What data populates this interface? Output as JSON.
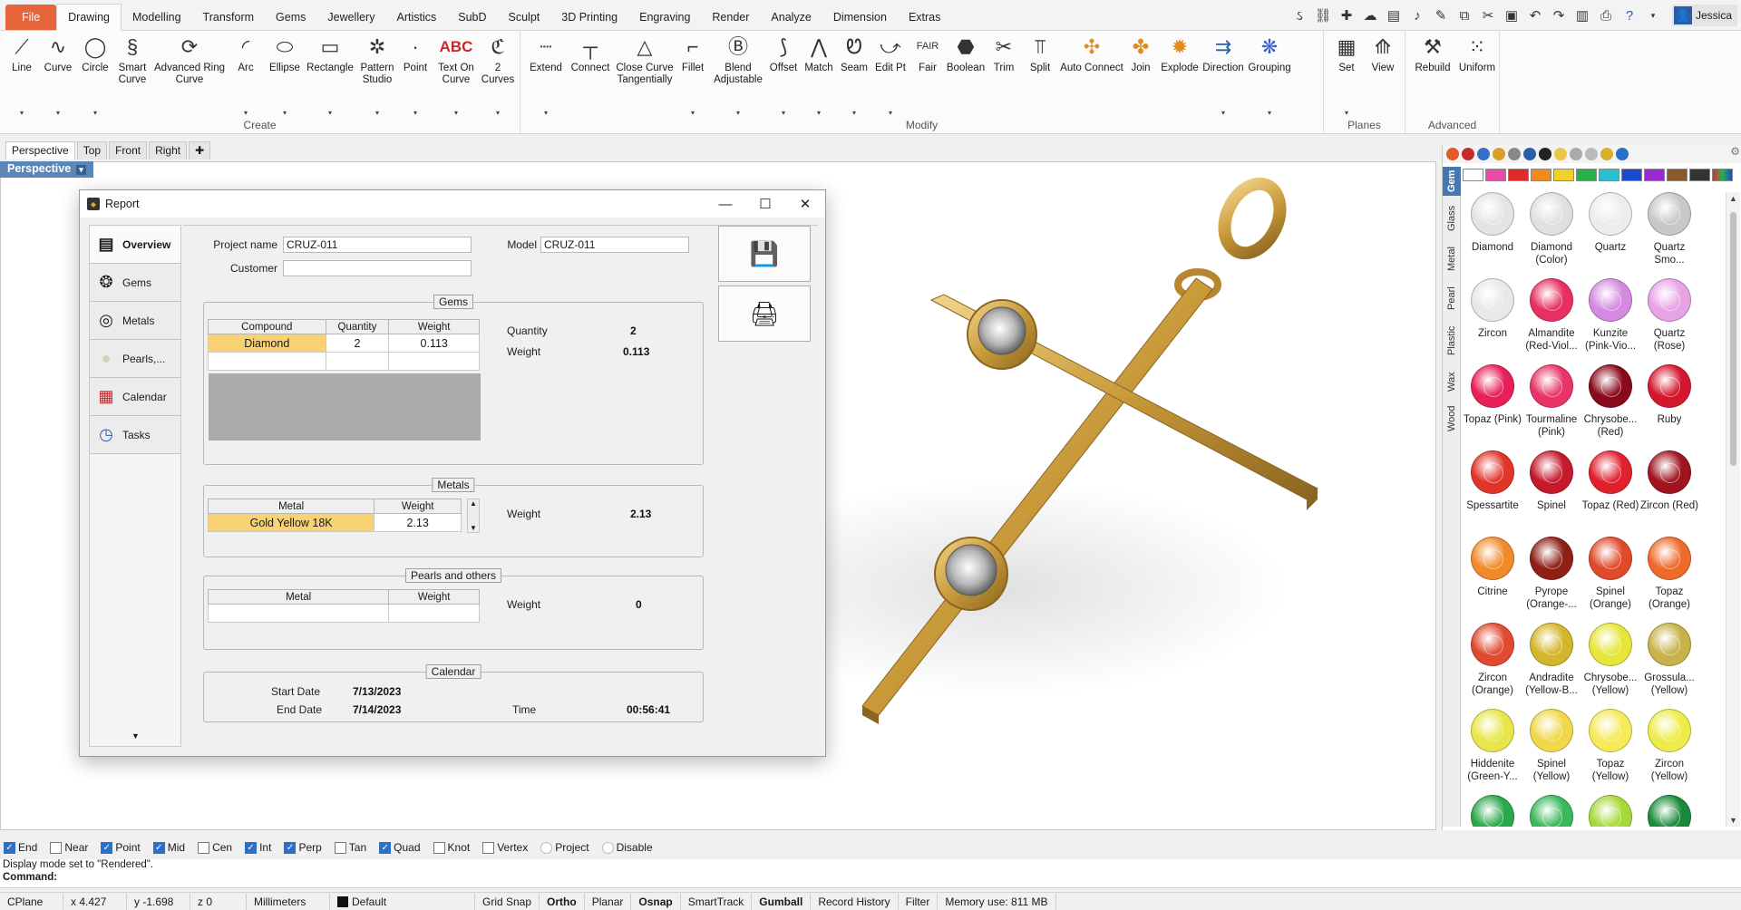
{
  "ribbon_tabs": [
    "File",
    "Drawing",
    "Modelling",
    "Transform",
    "Gems",
    "Jewellery",
    "Artistics",
    "SubD",
    "Sculpt",
    "3D Printing",
    "Engraving",
    "Render",
    "Analyze",
    "Dimension",
    "Extras"
  ],
  "active_tab": "Drawing",
  "user": "Jessica",
  "ribbon": {
    "create": {
      "label": "Create",
      "buttons": [
        "Line",
        "Curve",
        "Circle",
        "Smart Curve",
        "Advanced Ring Curve",
        "Arc",
        "Ellipse",
        "Rectangle",
        "Pattern Studio",
        "Point",
        "Text On Curve",
        "2 Curves"
      ]
    },
    "modify": {
      "label": "Modify",
      "buttons": [
        "Extend",
        "Connect",
        "Close Curve Tangentially",
        "Fillet",
        "Blend Adjustable",
        "Offset",
        "Match",
        "Seam",
        "Edit Pt",
        "Fair",
        "Boolean",
        "Trim",
        "Split",
        "Auto Connect",
        "Join",
        "Explode",
        "Direction",
        "Grouping"
      ]
    },
    "planes": {
      "label": "Planes",
      "buttons": [
        "Set",
        "View"
      ]
    },
    "advanced": {
      "label": "Advanced",
      "buttons": [
        "Rebuild",
        "Uniform"
      ]
    }
  },
  "viewport_tabs": [
    "Perspective",
    "Top",
    "Front",
    "Right"
  ],
  "viewport_label": "Perspective",
  "report": {
    "title": "Report",
    "nav": [
      "Overview",
      "Gems",
      "Metals",
      "Pearls,...",
      "Calendar",
      "Tasks"
    ],
    "project_name_label": "Project name",
    "project_name": "CRUZ-011",
    "model_label": "Model",
    "model": "CRUZ-011",
    "customer_label": "Customer",
    "customer": "",
    "gems": {
      "title": "Gems",
      "headers": [
        "Compound",
        "Quantity",
        "Weight"
      ],
      "rows": [
        {
          "compound": "Diamond",
          "quantity": "2",
          "weight": "0.113"
        }
      ],
      "quantity_label": "Quantity",
      "quantity_value": "2",
      "weight_label": "Weight",
      "weight_value": "0.113"
    },
    "metals": {
      "title": "Metals",
      "headers": [
        "Metal",
        "Weight"
      ],
      "rows": [
        {
          "metal": "Gold Yellow 18K",
          "weight": "2.13"
        }
      ],
      "weight_label": "Weight",
      "weight_value": "2.13"
    },
    "pearls": {
      "title": "Pearls and others",
      "headers": [
        "Metal",
        "Weight"
      ],
      "weight_label": "Weight",
      "weight_value": "0"
    },
    "calendar": {
      "title": "Calendar",
      "start_label": "Start Date",
      "start_value": "7/13/2023",
      "end_label": "End Date",
      "end_value": "7/14/2023",
      "time_label": "Time",
      "time_value": "00:56:41"
    }
  },
  "materials": {
    "tabs": [
      "Gem",
      "Glass",
      "Metal",
      "Pearl",
      "Plastic",
      "Wax",
      "Wood"
    ],
    "gems": [
      {
        "name": "Diamond",
        "color": "#e4e4e4"
      },
      {
        "name": "Diamond (Color)",
        "color": "#e0e0e0"
      },
      {
        "name": "Quartz",
        "color": "#ececec"
      },
      {
        "name": "Quartz Smo...",
        "color": "#c8c8c8"
      },
      {
        "name": "Zircon",
        "color": "#e8e8e8"
      },
      {
        "name": "Almandite (Red-Viol...",
        "color": "#e83060"
      },
      {
        "name": "Kunzite (Pink-Vio...",
        "color": "#d48ae0"
      },
      {
        "name": "Quartz (Rose)",
        "color": "#e8a2e6"
      },
      {
        "name": "Topaz (Pink)",
        "color": "#e8205a"
      },
      {
        "name": "Tourmaline (Pink)",
        "color": "#e83466"
      },
      {
        "name": "Chrysobe... (Red)",
        "color": "#8a0a1c"
      },
      {
        "name": "Ruby",
        "color": "#d3182e"
      },
      {
        "name": "Spessartite",
        "color": "#e0362a"
      },
      {
        "name": "Spinel",
        "color": "#c41a2c"
      },
      {
        "name": "Topaz (Red)",
        "color": "#e0202c"
      },
      {
        "name": "Zircon (Red)",
        "color": "#a01420"
      },
      {
        "name": "Citrine",
        "color": "#f08a2a"
      },
      {
        "name": "Pyrope (Orange-...",
        "color": "#8e2018"
      },
      {
        "name": "Spinel (Orange)",
        "color": "#e04a2a"
      },
      {
        "name": "Topaz (Orange)",
        "color": "#ee6a2a"
      },
      {
        "name": "Zircon (Orange)",
        "color": "#e04a30"
      },
      {
        "name": "Andradite (Yellow-B...",
        "color": "#d4b62a"
      },
      {
        "name": "Chrysobe... (Yellow)",
        "color": "#e6e63a"
      },
      {
        "name": "Grossula... (Yellow)",
        "color": "#c8b24a"
      },
      {
        "name": "Hiddenite (Green-Y...",
        "color": "#e8e64a"
      },
      {
        "name": "Spinel (Yellow)",
        "color": "#f0d84a"
      },
      {
        "name": "Topaz (Yellow)",
        "color": "#f4ea5a"
      },
      {
        "name": "Zircon (Yellow)",
        "color": "#ecec4a"
      },
      {
        "name": "",
        "color": "#2aa84a"
      },
      {
        "name": "",
        "color": "#3ab85a"
      },
      {
        "name": "",
        "color": "#a6d83a"
      },
      {
        "name": "",
        "color": "#1a8a3a"
      }
    ]
  },
  "osnap": [
    {
      "label": "End",
      "on": true
    },
    {
      "label": "Near",
      "on": false
    },
    {
      "label": "Point",
      "on": true
    },
    {
      "label": "Mid",
      "on": true
    },
    {
      "label": "Cen",
      "on": false
    },
    {
      "label": "Int",
      "on": true
    },
    {
      "label": "Perp",
      "on": true
    },
    {
      "label": "Tan",
      "on": false
    },
    {
      "label": "Quad",
      "on": true
    },
    {
      "label": "Knot",
      "on": false
    },
    {
      "label": "Vertex",
      "on": false
    },
    {
      "label": "Project",
      "on": false,
      "disabled": true
    },
    {
      "label": "Disable",
      "on": false,
      "disabled": true
    }
  ],
  "command_history": "Display mode set to \"Rendered\".",
  "command_prompt": "Command:",
  "status": {
    "cplane": "CPlane",
    "x": "x 4.427",
    "y": "y -1.698",
    "z": "z 0",
    "units": "Millimeters",
    "layer": "Default",
    "items": [
      "Grid Snap",
      "Ortho",
      "Planar",
      "Osnap",
      "SmartTrack",
      "Gumball",
      "Record History",
      "Filter"
    ],
    "bold_items": [
      "Ortho",
      "Osnap",
      "Gumball"
    ],
    "memory": "Memory use: 811 MB"
  }
}
